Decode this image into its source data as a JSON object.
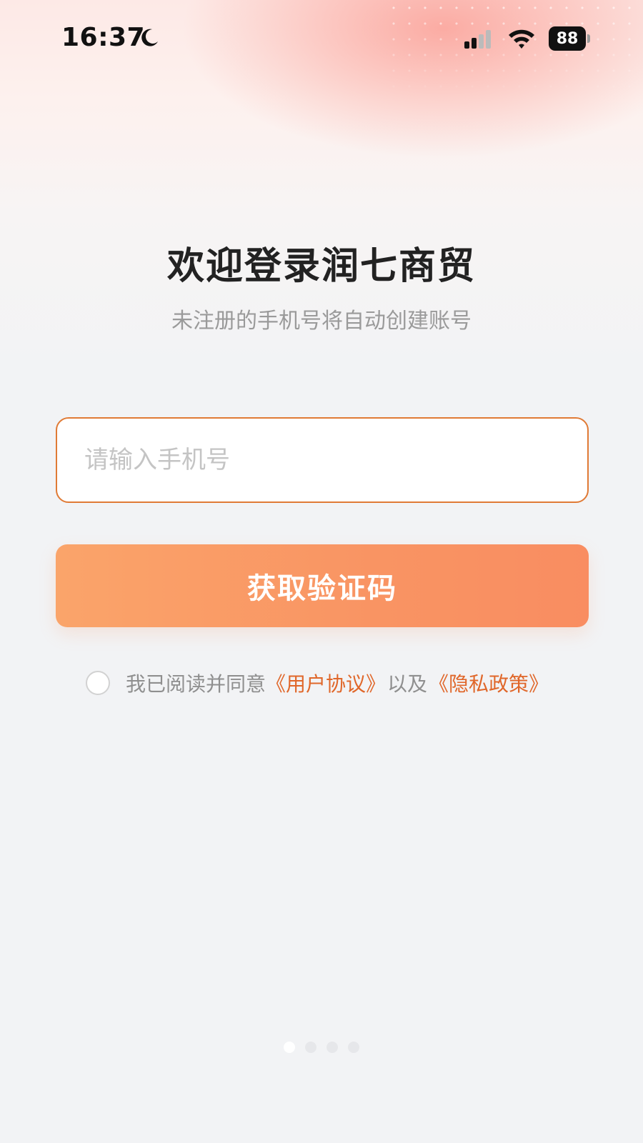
{
  "status_bar": {
    "time": "16:37",
    "battery_level": "88",
    "icons": [
      "moon-icon",
      "signal-icon",
      "wifi-icon",
      "battery-icon"
    ]
  },
  "login": {
    "title": "欢迎登录润七商贸",
    "subtitle": "未注册的手机号将自动创建账号",
    "phone_input": {
      "placeholder": "请输入手机号",
      "value": ""
    },
    "get_code_button": "获取验证码",
    "agreement": {
      "checked": false,
      "prefix": "我已阅读并同意",
      "user_agreement": "《用户协议》",
      "conjunction": "以及",
      "privacy_policy": "《隐私政策》"
    }
  },
  "pager": {
    "count": 4,
    "active_index": 0
  },
  "colors": {
    "accent": "#e0672a",
    "button_start": "#faa46a",
    "button_end": "#f98d61",
    "background": "#f2f3f5"
  }
}
